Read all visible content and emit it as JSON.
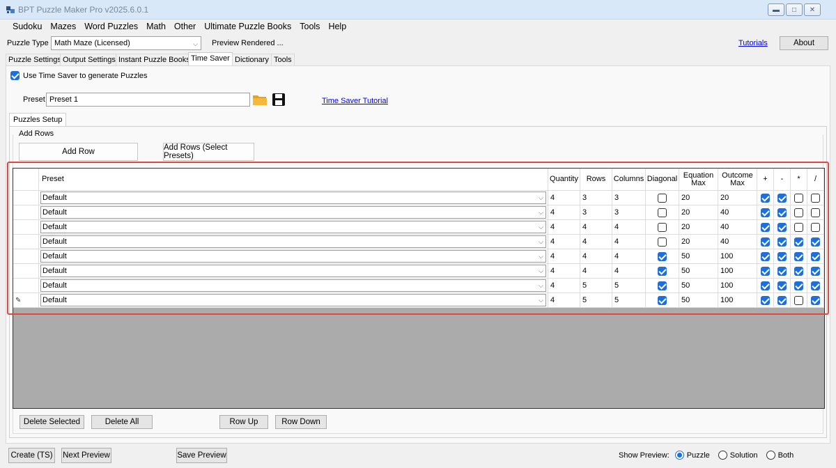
{
  "window": {
    "title": "BPT Puzzle Maker Pro v2025.6.0.1"
  },
  "menu": [
    "Sudoku",
    "Mazes",
    "Word Puzzles",
    "Math",
    "Other",
    "Ultimate Puzzle Books",
    "Tools",
    "Help"
  ],
  "puzzle_type": {
    "label": "Puzzle Type",
    "value": "Math Maze (Licensed)",
    "preview_status": "Preview Rendered ..."
  },
  "links": {
    "tutorials": "Tutorials",
    "time_saver_tutorial": "Time Saver Tutorial"
  },
  "buttons": {
    "about": "About",
    "add_row": "Add Row",
    "add_rows_presets": "Add Rows (Select Presets)",
    "delete_selected": "Delete Selected",
    "delete_all": "Delete All",
    "row_up": "Row Up",
    "row_down": "Row Down",
    "create_ts": "Create (TS)",
    "next_preview": "Next Preview",
    "save_preview": "Save Preview"
  },
  "tabs": [
    "Puzzle Settings",
    "Output Settings",
    "Instant Puzzle Books",
    "Time Saver",
    "Dictionary",
    "Tools"
  ],
  "active_tab": "Time Saver",
  "use_time_saver": {
    "label": "Use Time Saver to generate Puzzles",
    "checked": true
  },
  "preset": {
    "label": "Preset",
    "value": "Preset 1"
  },
  "inner_tab": "Puzzles Setup",
  "group_label": "Add Rows",
  "grid": {
    "columns": [
      "Preset",
      "Quantity",
      "Rows",
      "Columns",
      "Diagonal",
      "Equation Max",
      "Outcome Max",
      "+",
      "-",
      "*",
      "/"
    ],
    "rows": [
      {
        "preset": "Default",
        "quantity": "4",
        "rows": "3",
        "columns": "3",
        "diagonal": false,
        "eq_max": "20",
        "out_max": "20",
        "plus": true,
        "minus": true,
        "mul": false,
        "div": false
      },
      {
        "preset": "Default",
        "quantity": "4",
        "rows": "3",
        "columns": "3",
        "diagonal": false,
        "eq_max": "20",
        "out_max": "40",
        "plus": true,
        "minus": true,
        "mul": false,
        "div": false
      },
      {
        "preset": "Default",
        "quantity": "4",
        "rows": "4",
        "columns": "4",
        "diagonal": false,
        "eq_max": "20",
        "out_max": "40",
        "plus": true,
        "minus": true,
        "mul": false,
        "div": false
      },
      {
        "preset": "Default",
        "quantity": "4",
        "rows": "4",
        "columns": "4",
        "diagonal": false,
        "eq_max": "20",
        "out_max": "40",
        "plus": true,
        "minus": true,
        "mul": true,
        "div": true
      },
      {
        "preset": "Default",
        "quantity": "4",
        "rows": "4",
        "columns": "4",
        "diagonal": true,
        "eq_max": "50",
        "out_max": "100",
        "plus": true,
        "minus": true,
        "mul": true,
        "div": true
      },
      {
        "preset": "Default",
        "quantity": "4",
        "rows": "4",
        "columns": "4",
        "diagonal": true,
        "eq_max": "50",
        "out_max": "100",
        "plus": true,
        "minus": true,
        "mul": true,
        "div": true
      },
      {
        "preset": "Default",
        "quantity": "4",
        "rows": "5",
        "columns": "5",
        "diagonal": true,
        "eq_max": "50",
        "out_max": "100",
        "plus": true,
        "minus": true,
        "mul": true,
        "div": true
      },
      {
        "preset": "Default",
        "quantity": "4",
        "rows": "5",
        "columns": "5",
        "diagonal": true,
        "eq_max": "50",
        "out_max": "100",
        "plus": true,
        "minus": true,
        "mul": false,
        "div": true
      }
    ]
  },
  "show_preview": {
    "label": "Show Preview:",
    "options": [
      "Puzzle",
      "Solution",
      "Both"
    ],
    "selected": "Puzzle"
  },
  "colors": {
    "accent": "#1e6fd9",
    "highlight": "#e3463c",
    "grid_bg": "#ababab"
  }
}
